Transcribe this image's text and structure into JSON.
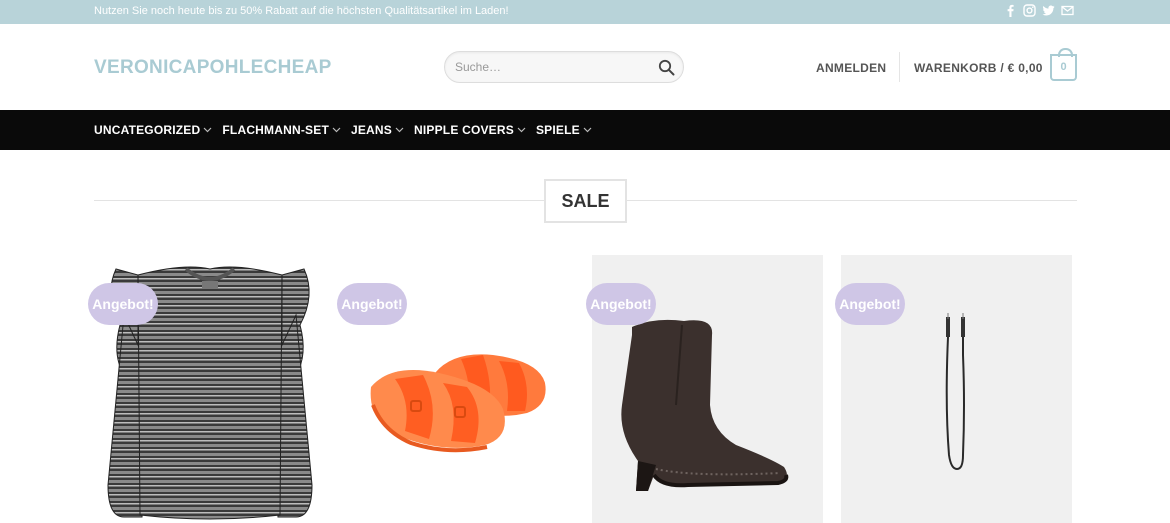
{
  "topbar": {
    "message": "Nutzen Sie noch heute bis zu 50% Rabatt auf die höchsten Qualitätsartikel im Laden!",
    "social_icons": [
      "facebook-icon",
      "instagram-icon",
      "twitter-icon",
      "envelope-icon"
    ]
  },
  "header": {
    "logo": "VERONICAPOHLECHEAP",
    "search_placeholder": "Suche…",
    "login": "ANMELDEN",
    "cart_label": "WARENKORB / € 0,00",
    "cart_count": "0"
  },
  "nav": {
    "items": [
      {
        "label": "UNCATEGORIZED"
      },
      {
        "label": "FLACHMANN-SET"
      },
      {
        "label": "JEANS"
      },
      {
        "label": "NIPPLE COVERS"
      },
      {
        "label": "SPIELE"
      }
    ]
  },
  "section": {
    "title": "SALE"
  },
  "products": [
    {
      "badge": "Angebot!",
      "image": "striped-ruffle-sweater"
    },
    {
      "badge": "Angebot!",
      "image": "orange-double-buckle-sandals"
    },
    {
      "badge": "Angebot!",
      "image": "brown-suede-heeled-boot"
    },
    {
      "badge": "Angebot!",
      "image": "black-cable-cord"
    }
  ],
  "colors": {
    "topbar_bg": "#b8d3d9",
    "accent": "#a9cbd3",
    "nav_bg": "#0a0a0a",
    "badge_bg": "#cfc6e6"
  }
}
